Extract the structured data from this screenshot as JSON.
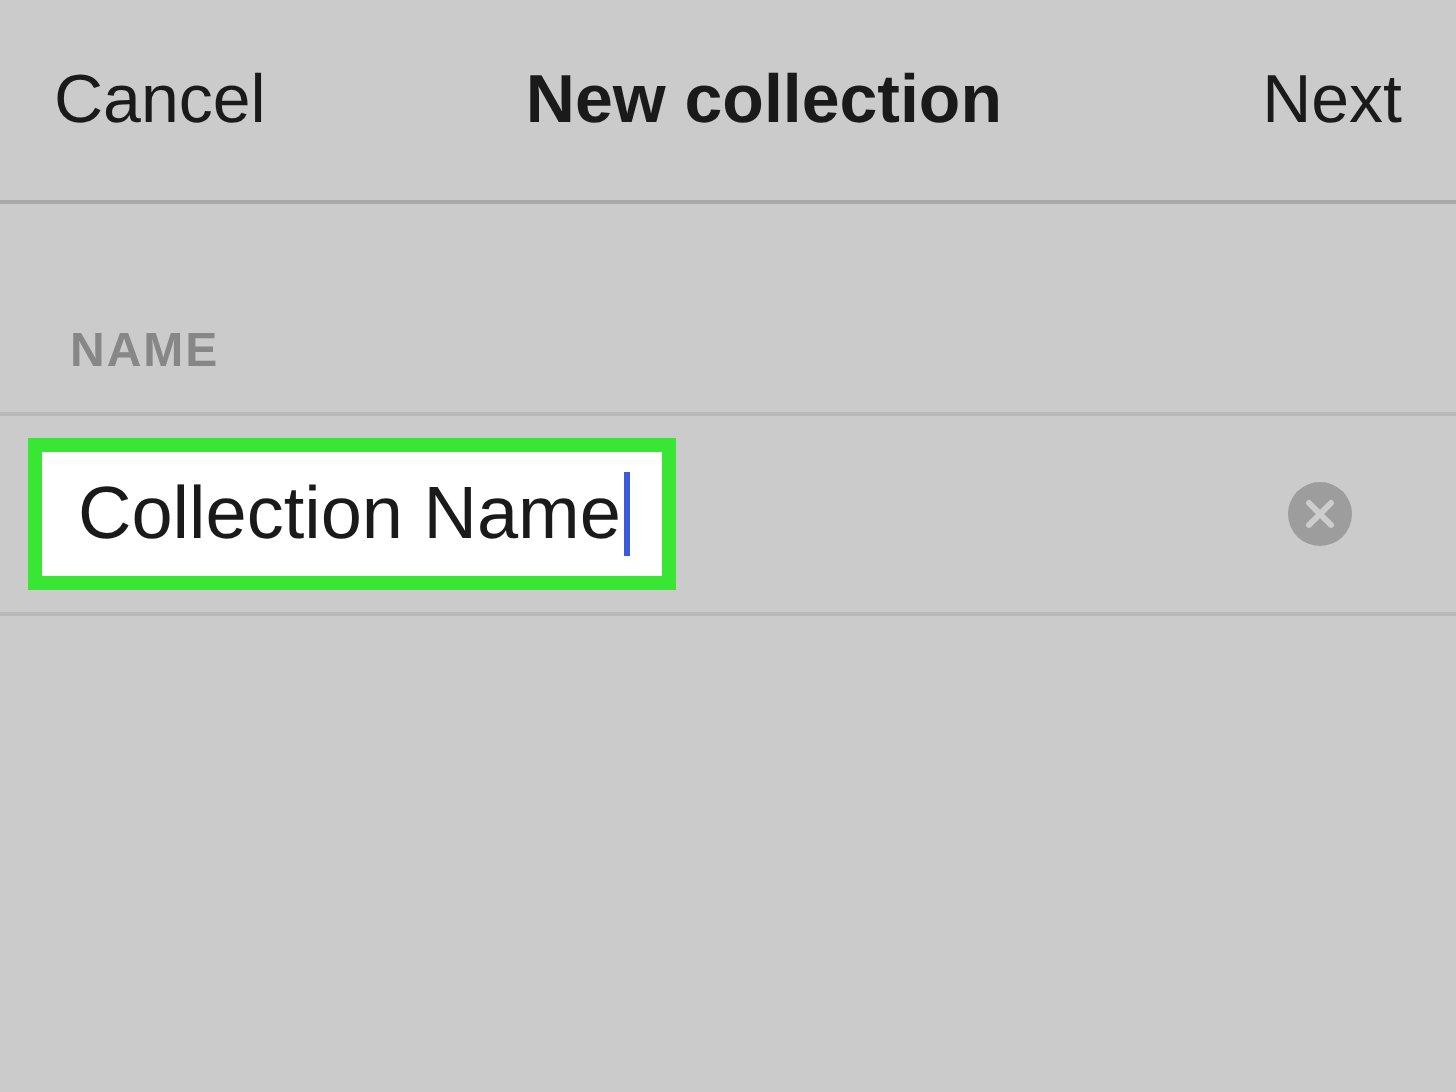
{
  "header": {
    "cancel": "Cancel",
    "title": "New collection",
    "next": "Next"
  },
  "section": {
    "label": "NAME"
  },
  "field": {
    "value": "Collection Name",
    "focused": true,
    "highlighted": true
  }
}
